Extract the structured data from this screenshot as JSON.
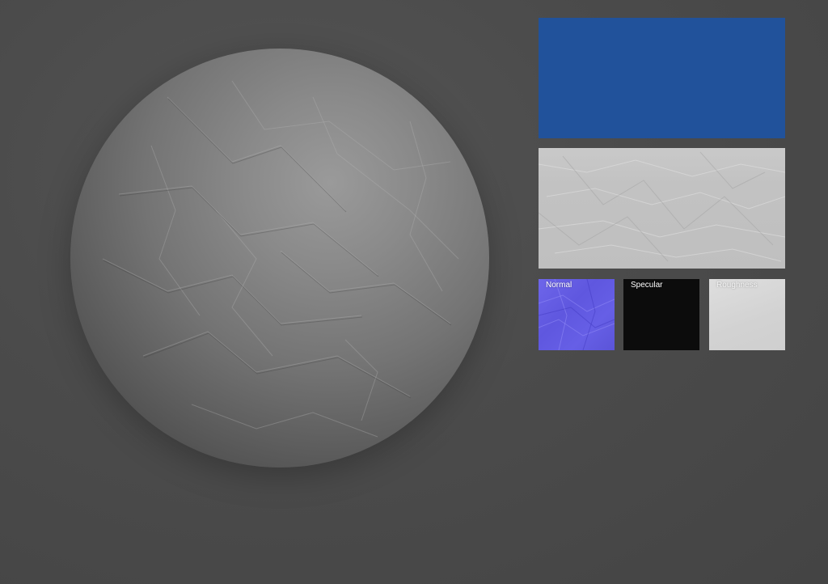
{
  "scene": {
    "background_color": "#4a4a4a",
    "material_preview": "sphere"
  },
  "maps": {
    "base_color": {
      "label": "",
      "color": "#21529b"
    },
    "height": {
      "label": "",
      "color": "#c4c4c4"
    },
    "normal": {
      "label": "Normal",
      "color": "#6660e4"
    },
    "specular": {
      "label": "Specular",
      "color": "#0c0c0c"
    },
    "roughness": {
      "label": "Roughness",
      "color": "#d6d6d6"
    }
  }
}
